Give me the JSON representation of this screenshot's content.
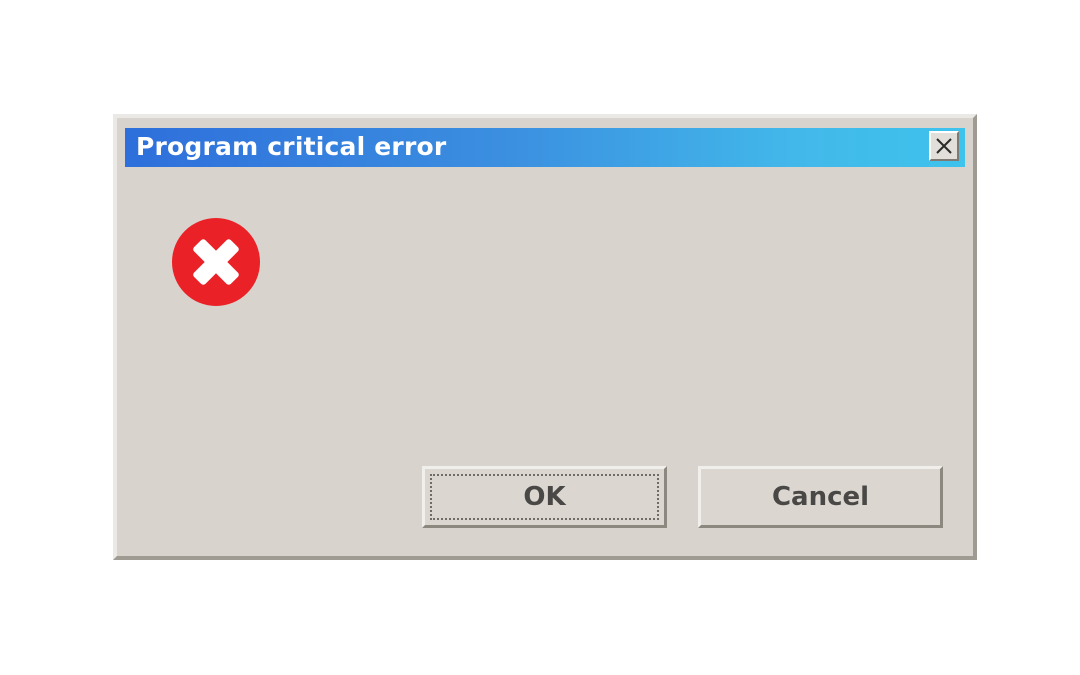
{
  "dialog": {
    "title": "Program critical error",
    "close_icon": "close-icon",
    "status_icon": "error-icon",
    "buttons": {
      "ok_label": "OK",
      "cancel_label": "Cancel"
    }
  },
  "colors": {
    "titlebar_start": "#2e6fdb",
    "titlebar_end": "#3ec3ec",
    "dialog_body": "#d8d4cd",
    "error_red": "#ea2127"
  }
}
